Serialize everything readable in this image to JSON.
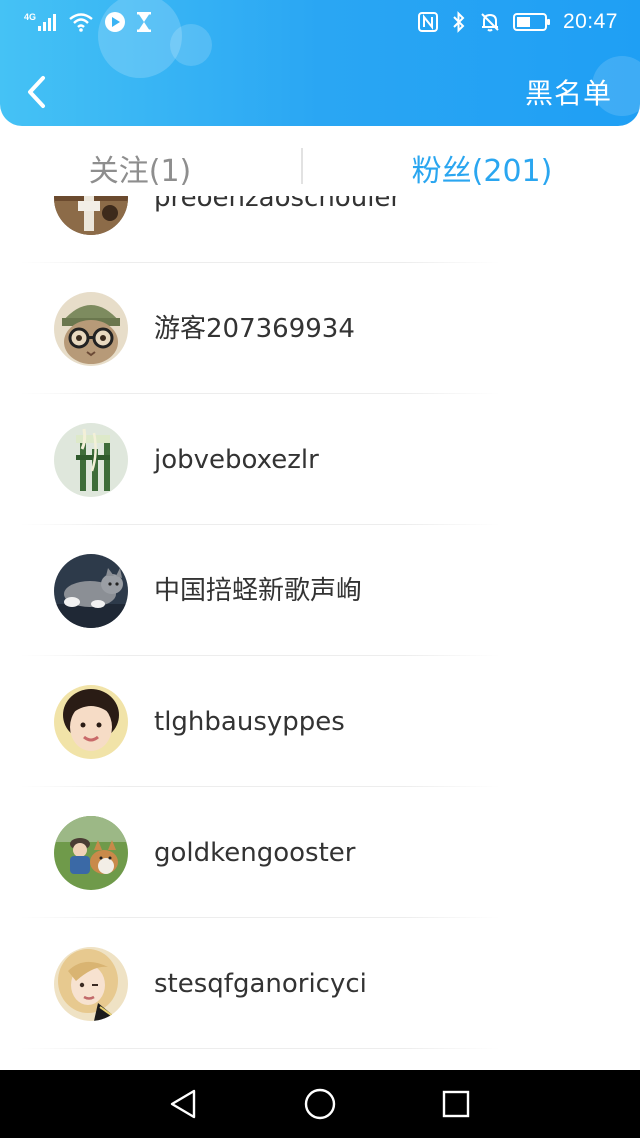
{
  "status_bar": {
    "network": "4G",
    "time": "20:47",
    "icons": [
      "signal-icon",
      "wifi-icon",
      "play-icon",
      "hourglass-icon",
      "nfc-icon",
      "bluetooth-icon",
      "mute-bell-icon",
      "battery-icon"
    ]
  },
  "header": {
    "back_icon": "chevron-left-icon",
    "action_label": "黑名单",
    "colors": {
      "gradient_start": "#45c2f5",
      "gradient_end": "#1f9ff4"
    }
  },
  "tabs": {
    "following": "关注(1)",
    "fans": "粉丝(201)",
    "active": "fans",
    "active_color": "#2aa6f0",
    "inactive_color": "#8e8e8e"
  },
  "fans": [
    {
      "name": "preoenzaoschouier",
      "avatar": "cat-on-stairs"
    },
    {
      "name": "游客207369934",
      "avatar": "cat-with-glasses"
    },
    {
      "name": "jobveboxezlr",
      "avatar": "green-chair"
    },
    {
      "name": "中国掊蛏新歌声峋",
      "avatar": "grey-cat"
    },
    {
      "name": "tlghbausyppes",
      "avatar": "smiling-child"
    },
    {
      "name": "goldkengooster",
      "avatar": "child-with-dog"
    },
    {
      "name": "stesqfganoricyci",
      "avatar": "blonde-woman"
    }
  ],
  "nav_bar": {
    "icons": [
      "nav-back-icon",
      "nav-home-icon",
      "nav-recent-icon"
    ]
  }
}
